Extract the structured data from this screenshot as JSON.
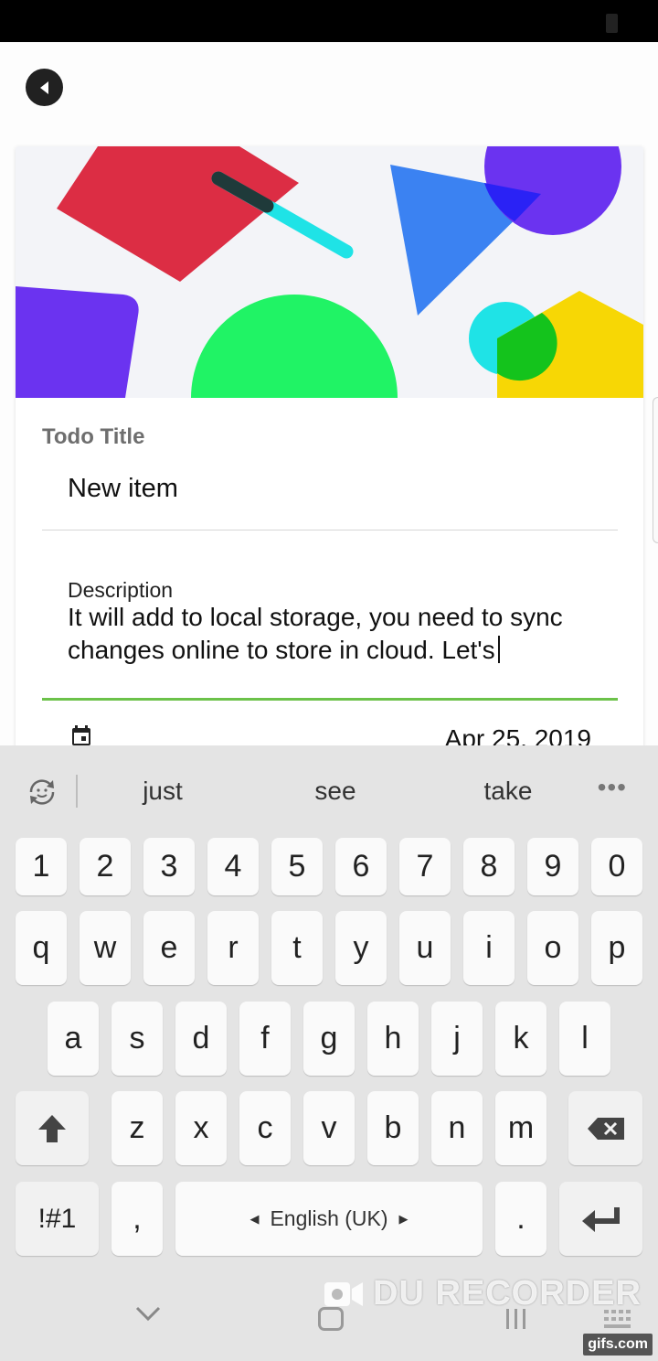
{
  "form": {
    "title_label": "Todo Title",
    "title_value": "New item",
    "description_label": "Description",
    "description_value": "It will add to local storage,  you need to sync changes online to store in cloud. Let's",
    "date_value": "Apr 25, 2019"
  },
  "keyboard": {
    "suggestions": [
      "just",
      "see",
      "take"
    ],
    "rows": [
      [
        "1",
        "2",
        "3",
        "4",
        "5",
        "6",
        "7",
        "8",
        "9",
        "0"
      ],
      [
        "q",
        "w",
        "e",
        "r",
        "t",
        "y",
        "u",
        "i",
        "o",
        "p"
      ],
      [
        "a",
        "s",
        "d",
        "f",
        "g",
        "h",
        "j",
        "k",
        "l"
      ],
      [
        "z",
        "x",
        "c",
        "v",
        "b",
        "n",
        "m"
      ]
    ],
    "symbols_key": "!#1",
    "comma_key": ",",
    "period_key": ".",
    "space_label": "English (UK)"
  },
  "overlay": {
    "recorder_watermark": "DU RECORDER",
    "gifs_badge": "gifs.com"
  },
  "colors": {
    "accent_underline": "#6cc24a",
    "keyboard_bg": "#e4e4e4"
  }
}
